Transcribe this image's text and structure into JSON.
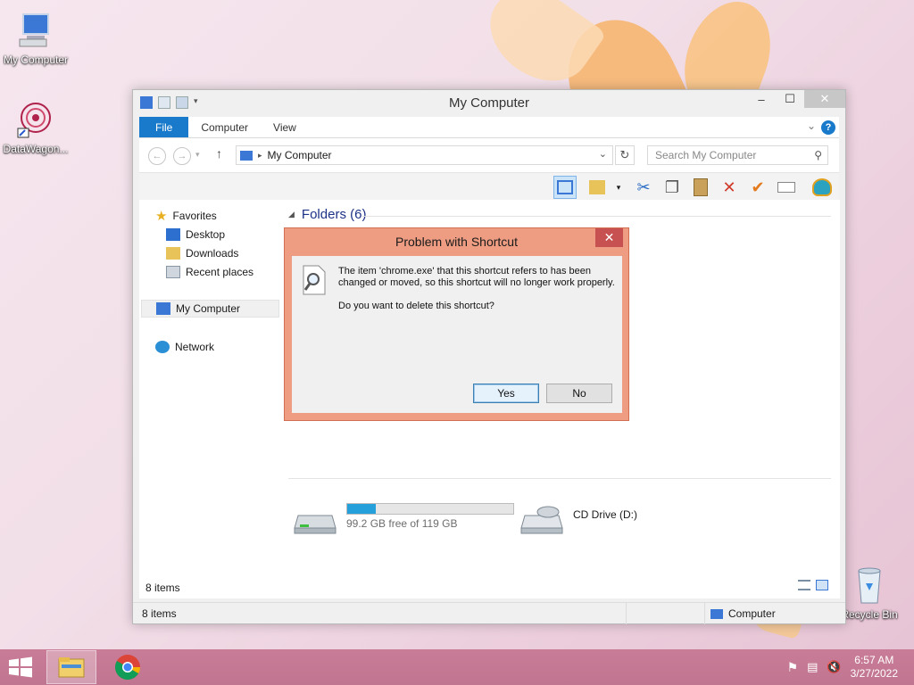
{
  "desktop": {
    "icons": [
      {
        "label": "My Computer",
        "icon": "computer-icon"
      },
      {
        "label": "DataWagon...",
        "icon": "datawagon-icon"
      },
      {
        "label": "Recycle Bin",
        "icon": "recycle-bin-icon"
      }
    ]
  },
  "window": {
    "title": "My Computer",
    "tabs": {
      "file": "File",
      "computer": "Computer",
      "view": "View"
    },
    "help_label": "?",
    "address": {
      "location": "My Computer"
    },
    "search": {
      "placeholder": "Search My Computer"
    },
    "nav": {
      "favorites": "Favorites",
      "desktop": "Desktop",
      "downloads": "Downloads",
      "recent": "Recent places",
      "mycomputer": "My Computer",
      "network": "Network"
    },
    "group": {
      "label": "Folders (6)"
    },
    "drives": [
      {
        "name": "",
        "free_text": "99.2 GB free of 119 GB",
        "used_fraction": 0.17
      },
      {
        "name": "CD Drive (D:)"
      }
    ],
    "pane_status": "8 items",
    "statusbar": {
      "items": "8 items",
      "location": "Computer"
    }
  },
  "dialog": {
    "title": "Problem with Shortcut",
    "close_label": "✕",
    "message": "The item 'chrome.exe' that this shortcut refers to has been changed or moved, so this shortcut will no longer work properly.",
    "question": "Do you want to delete this shortcut?",
    "yes": "Yes",
    "no": "No"
  },
  "taskbar": {
    "time": "6:57 AM",
    "date": "3/27/2022"
  },
  "colors": {
    "accent": "#1979ca",
    "dialog_frame": "#ee9d82",
    "dialog_close": "#c75050",
    "taskbar": "#c57993"
  }
}
